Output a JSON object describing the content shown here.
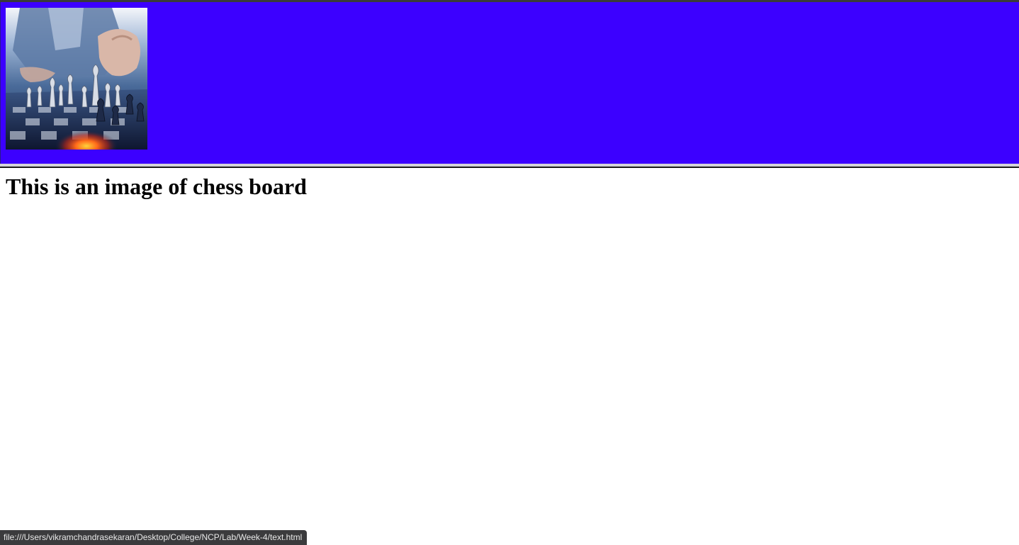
{
  "page": {
    "heading": "This is an image of chess board",
    "banner_color": "#3c00ff"
  },
  "image": {
    "alt": "chess board",
    "icon": "chess-board-photo"
  },
  "status_bar": {
    "url": "file:///Users/vikramchandrasekaran/Desktop/College/NCP/Lab/Week-4/text.html"
  }
}
